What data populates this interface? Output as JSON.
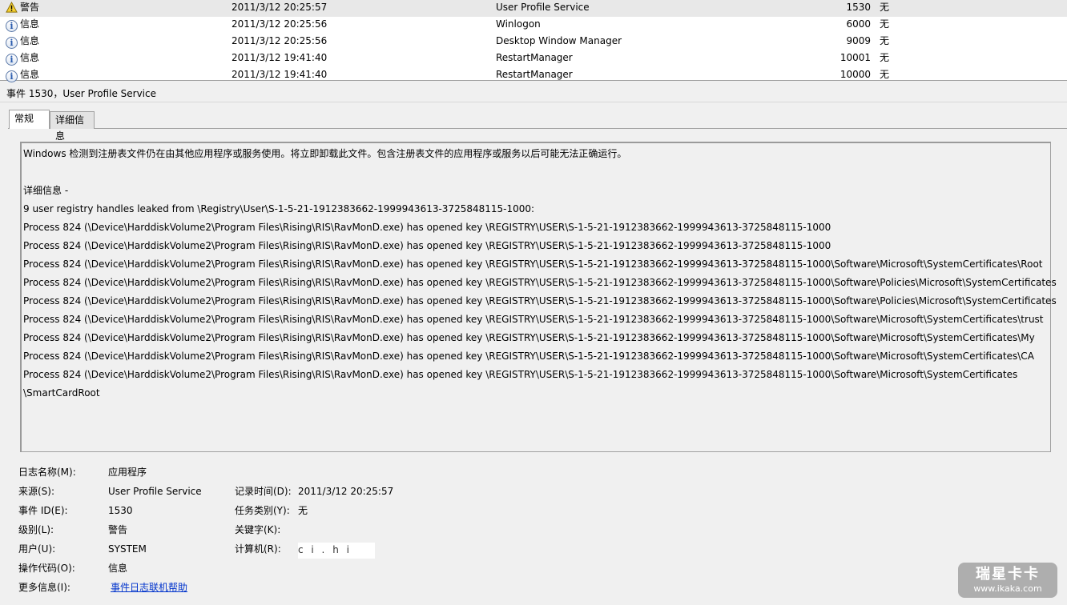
{
  "event_list": {
    "rows": [
      {
        "level": "警告",
        "level_icon": "warning-icon",
        "datetime": "2011/3/12 20:25:57",
        "source": "User Profile Service",
        "event_id": "1530",
        "category": "无",
        "selected": true
      },
      {
        "level": "信息",
        "level_icon": "info-icon",
        "datetime": "2011/3/12 20:25:56",
        "source": "Winlogon",
        "event_id": "6000",
        "category": "无",
        "selected": false
      },
      {
        "level": "信息",
        "level_icon": "info-icon",
        "datetime": "2011/3/12 20:25:56",
        "source": "Desktop Window Manager",
        "event_id": "9009",
        "category": "无",
        "selected": false
      },
      {
        "level": "信息",
        "level_icon": "info-icon",
        "datetime": "2011/3/12 19:41:40",
        "source": "RestartManager",
        "event_id": "10001",
        "category": "无",
        "selected": false
      },
      {
        "level": "信息",
        "level_icon": "info-icon",
        "datetime": "2011/3/12 19:41:40",
        "source": "RestartManager",
        "event_id": "10000",
        "category": "无",
        "selected": false
      }
    ]
  },
  "detail": {
    "header": "事件 1530，User Profile Service",
    "tabs": [
      "常规",
      "详细信息"
    ],
    "description_lines": [
      "Windows 检测到注册表文件仍在由其他应用程序或服务使用。将立即卸载此文件。包含注册表文件的应用程序或服务以后可能无法正确运行。",
      "",
      " 详细信息 -",
      " 9 user registry handles leaked from \\Registry\\User\\S-1-5-21-1912383662-1999943613-3725848115-1000:",
      "Process 824 (\\Device\\HarddiskVolume2\\Program Files\\Rising\\RIS\\RavMonD.exe) has opened key \\REGISTRY\\USER\\S-1-5-21-1912383662-1999943613-3725848115-1000",
      "Process 824 (\\Device\\HarddiskVolume2\\Program Files\\Rising\\RIS\\RavMonD.exe) has opened key \\REGISTRY\\USER\\S-1-5-21-1912383662-1999943613-3725848115-1000",
      "Process 824 (\\Device\\HarddiskVolume2\\Program Files\\Rising\\RIS\\RavMonD.exe) has opened key \\REGISTRY\\USER\\S-1-5-21-1912383662-1999943613-3725848115-1000\\Software\\Microsoft\\SystemCertificates\\Root",
      "Process 824 (\\Device\\HarddiskVolume2\\Program Files\\Rising\\RIS\\RavMonD.exe) has opened key \\REGISTRY\\USER\\S-1-5-21-1912383662-1999943613-3725848115-1000\\Software\\Policies\\Microsoft\\SystemCertificates",
      "Process 824 (\\Device\\HarddiskVolume2\\Program Files\\Rising\\RIS\\RavMonD.exe) has opened key \\REGISTRY\\USER\\S-1-5-21-1912383662-1999943613-3725848115-1000\\Software\\Policies\\Microsoft\\SystemCertificates",
      "Process 824 (\\Device\\HarddiskVolume2\\Program Files\\Rising\\RIS\\RavMonD.exe) has opened key \\REGISTRY\\USER\\S-1-5-21-1912383662-1999943613-3725848115-1000\\Software\\Microsoft\\SystemCertificates\\trust",
      "Process 824 (\\Device\\HarddiskVolume2\\Program Files\\Rising\\RIS\\RavMonD.exe) has opened key \\REGISTRY\\USER\\S-1-5-21-1912383662-1999943613-3725848115-1000\\Software\\Microsoft\\SystemCertificates\\My",
      "Process 824 (\\Device\\HarddiskVolume2\\Program Files\\Rising\\RIS\\RavMonD.exe) has opened key \\REGISTRY\\USER\\S-1-5-21-1912383662-1999943613-3725848115-1000\\Software\\Microsoft\\SystemCertificates\\CA",
      "Process 824 (\\Device\\HarddiskVolume2\\Program Files\\Rising\\RIS\\RavMonD.exe) has opened key \\REGISTRY\\USER\\S-1-5-21-1912383662-1999943613-3725848115-1000\\Software\\Microsoft\\SystemCertificates",
      "\\SmartCardRoot"
    ],
    "properties": {
      "log_name_label": "日志名称(M):",
      "log_name": "应用程序",
      "source_label": "来源(S):",
      "source": "User Profile Service",
      "logged_label": "记录时间(D):",
      "logged": "2011/3/12 20:25:57",
      "event_id_label": "事件 ID(E):",
      "event_id": "1530",
      "task_category_label": "任务类别(Y):",
      "task_category": "无",
      "level_label": "级别(L):",
      "level": "警告",
      "keywords_label": "关键字(K):",
      "keywords": "",
      "user_label": "用户(U):",
      "user": "SYSTEM",
      "computer_label": "计算机(R):",
      "computer": "c  i  .   h  i",
      "opcode_label": "操作代码(O):",
      "opcode": "信息",
      "more_info_label": "更多信息(I):",
      "more_info_link": "事件日志联机帮助"
    }
  },
  "watermark": {
    "title": "瑞星卡卡",
    "url": "www.ikaka.com"
  }
}
